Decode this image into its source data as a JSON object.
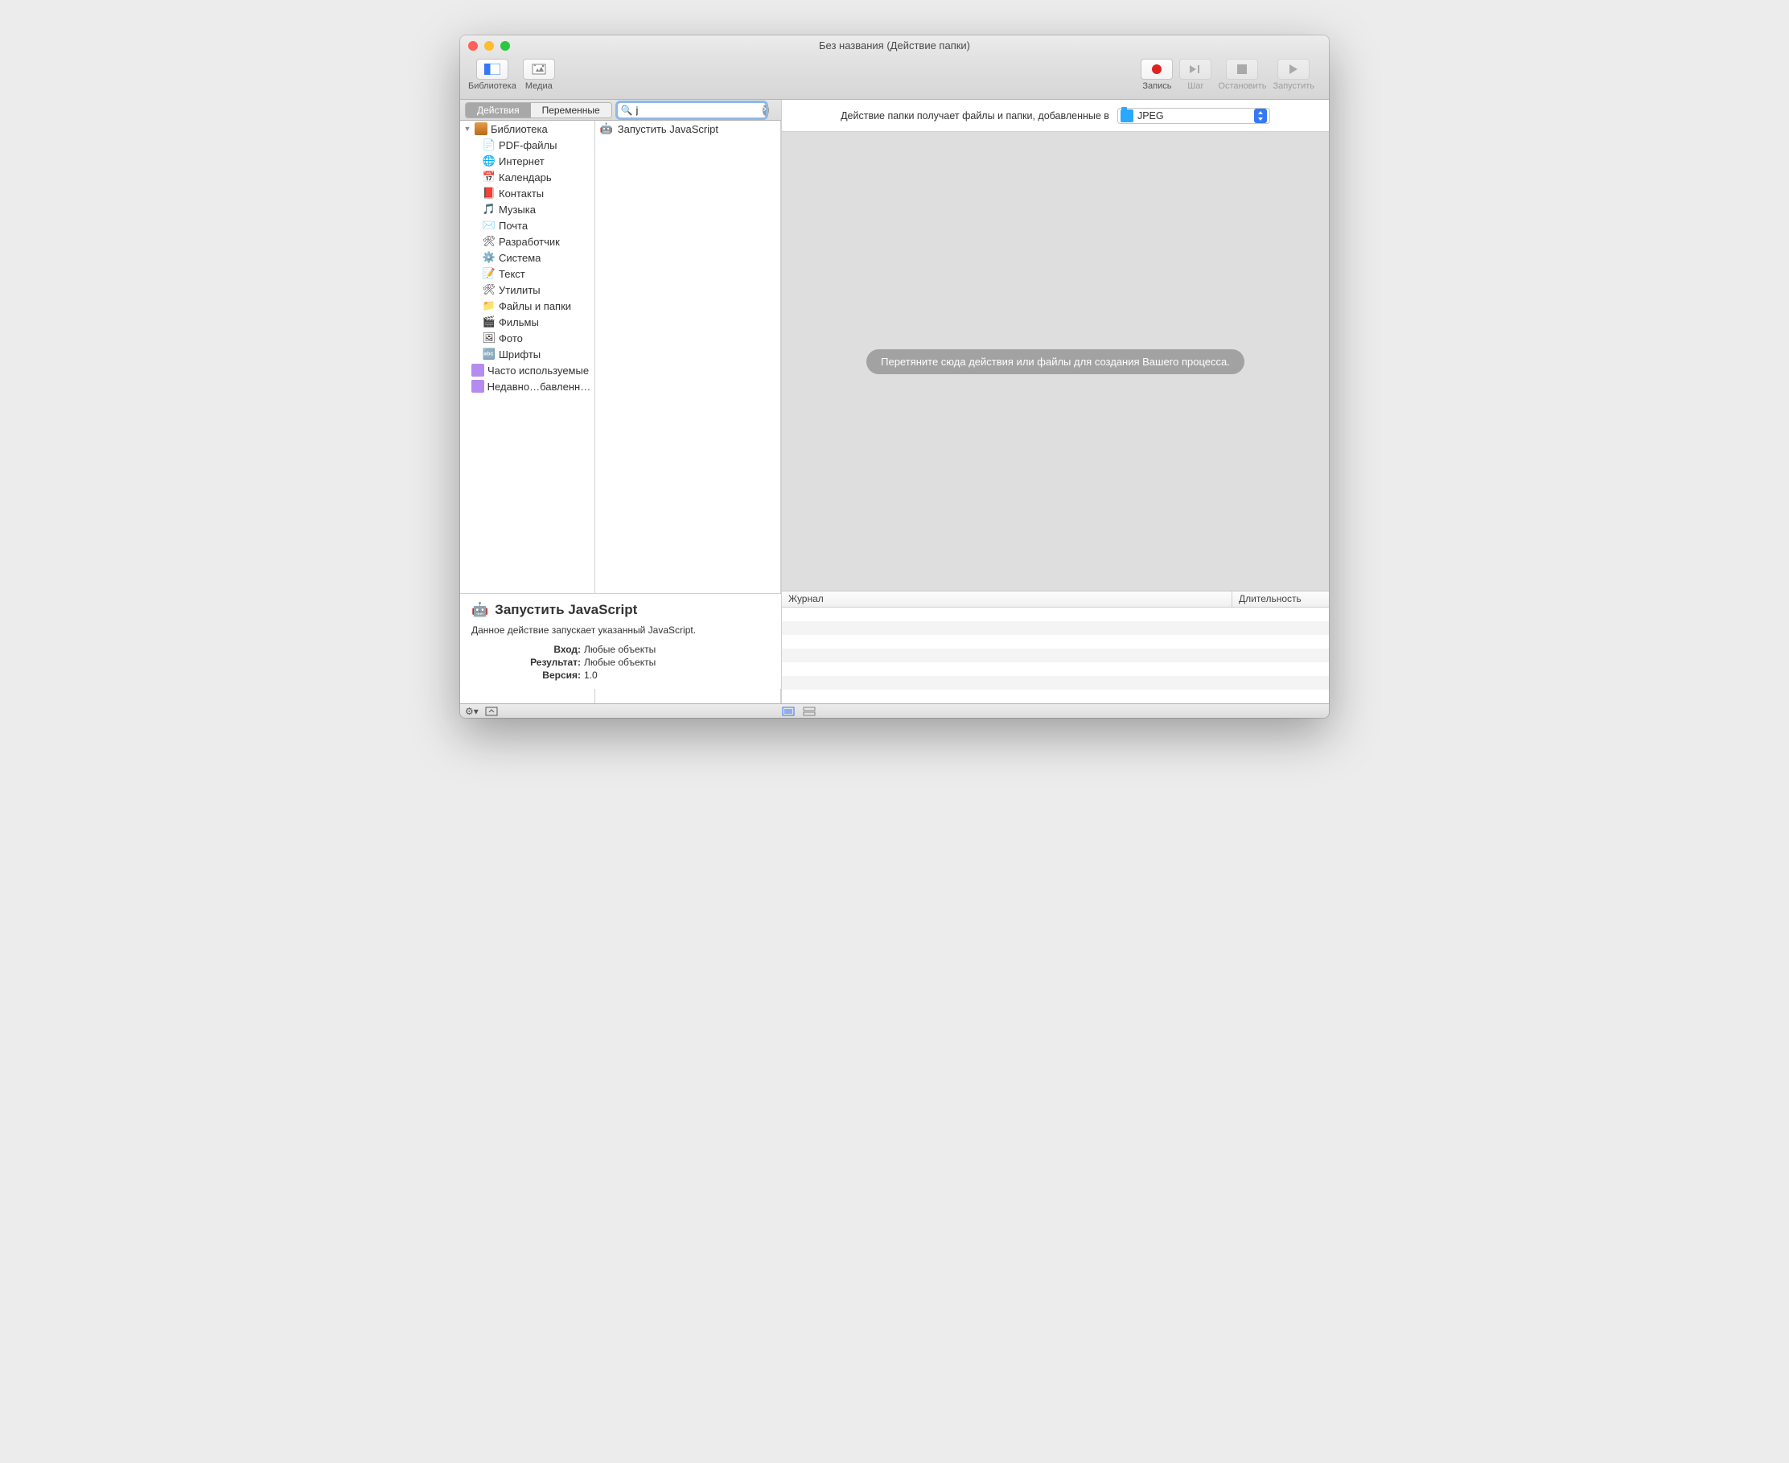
{
  "window": {
    "title": "Без названия (Действие папки)"
  },
  "toolbar": {
    "library": "Библиотека",
    "media": "Медиа",
    "record": "Запись",
    "step": "Шаг",
    "stop": "Остановить",
    "run": "Запустить"
  },
  "subtoolbar": {
    "actions": "Действия",
    "variables": "Переменные",
    "search_value": "j"
  },
  "sidebar": {
    "root": "Библиотека",
    "items": [
      {
        "label": "PDF-файлы",
        "icon": "📄"
      },
      {
        "label": "Интернет",
        "icon": "🌐"
      },
      {
        "label": "Календарь",
        "icon": "📅"
      },
      {
        "label": "Контакты",
        "icon": "📕"
      },
      {
        "label": "Музыка",
        "icon": "🎵"
      },
      {
        "label": "Почта",
        "icon": "✉️"
      },
      {
        "label": "Разработчик",
        "icon": "🛠"
      },
      {
        "label": "Система",
        "icon": "⚙️"
      },
      {
        "label": "Текст",
        "icon": "📝"
      },
      {
        "label": "Утилиты",
        "icon": "🛠"
      },
      {
        "label": "Файлы и папки",
        "icon": "📁"
      },
      {
        "label": "Фильмы",
        "icon": "🎬"
      },
      {
        "label": "Фото",
        "icon": "🖼"
      },
      {
        "label": "Шрифты",
        "icon": "🔤"
      }
    ],
    "smart": [
      {
        "label": "Часто используемые"
      },
      {
        "label": "Недавно…бавленные"
      }
    ]
  },
  "actions_list": {
    "items": [
      {
        "label": "Запустить JavaScript"
      }
    ]
  },
  "main": {
    "header_text": "Действие папки получает файлы и папки, добавленные в",
    "folder_selected": "JPEG",
    "canvas_hint": "Перетяните сюда действия или файлы для создания Вашего процесса."
  },
  "log": {
    "col_journal": "Журнал",
    "col_duration": "Длительность"
  },
  "info": {
    "title": "Запустить JavaScript",
    "description": "Данное действие запускает указанный JavaScript.",
    "input_label": "Вход:",
    "input_value": "Любые объекты",
    "result_label": "Результат:",
    "result_value": "Любые объекты",
    "version_label": "Версия:",
    "version_value": "1.0"
  }
}
